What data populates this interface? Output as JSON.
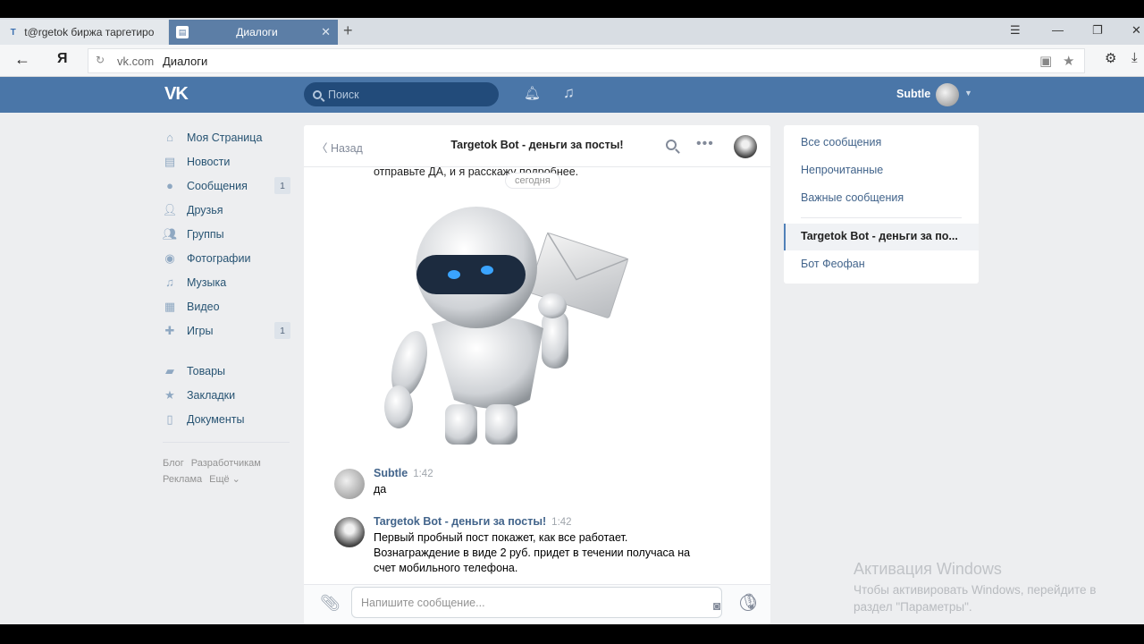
{
  "browser": {
    "tabs": [
      {
        "title": "t@rgetok биржа таргетиро",
        "favicon": "T"
      },
      {
        "title": "Диалоги",
        "favicon": "▤"
      }
    ],
    "new_tab": "+",
    "address": {
      "ya": "Я",
      "domain": "vk.com",
      "title": "Диалоги"
    }
  },
  "vk": {
    "logo": "VK",
    "search_placeholder": "Поиск",
    "username": "Subtle"
  },
  "sidebar": {
    "items": [
      {
        "label": "Моя Страница",
        "icon": "home-icon"
      },
      {
        "label": "Новости",
        "icon": "news-icon"
      },
      {
        "label": "Сообщения",
        "icon": "messages-icon",
        "badge": "1"
      },
      {
        "label": "Друзья",
        "icon": "friends-icon"
      },
      {
        "label": "Группы",
        "icon": "groups-icon"
      },
      {
        "label": "Фотографии",
        "icon": "camera-icon"
      },
      {
        "label": "Музыка",
        "icon": "music-icon"
      },
      {
        "label": "Видео",
        "icon": "video-icon"
      },
      {
        "label": "Игры",
        "icon": "games-icon",
        "badge": "1"
      }
    ],
    "items2": [
      {
        "label": "Товары",
        "icon": "bag-icon"
      },
      {
        "label": "Закладки",
        "icon": "star-icon"
      },
      {
        "label": "Документы",
        "icon": "doc-icon"
      }
    ],
    "footer": {
      "blog": "Блог",
      "dev": "Разработчикам",
      "ads": "Реклама",
      "more": "Ещё ⌄"
    }
  },
  "dialog": {
    "back_label": "Назад",
    "title": "Targetok Bot - деньги за посты!",
    "prev_text": "отправьте ДА, и я расскажу подробнее.",
    "date_label": "сегодня",
    "messages": [
      {
        "author": "Subtle",
        "time": "1:42",
        "text": "да"
      },
      {
        "author": "Targetok Bot - деньги за посты!",
        "time": "1:42",
        "text": "Первый пробный пост покажет, как все работает. Вознаграждение в виде 2 руб. придет в течении получаса на счет мобильного телефона."
      }
    ],
    "composer_placeholder": "Напишите сообщение..."
  },
  "folders": {
    "items": [
      "Все сообщения",
      "Непрочитанные",
      "Важные сообщения"
    ],
    "chats": [
      "Targetok Bot - деньги за по...",
      "Бот Феофан"
    ]
  },
  "watermark": {
    "title": "Активация Windows",
    "text": "Чтобы активировать Windows, перейдите в раздел \"Параметры\"."
  }
}
